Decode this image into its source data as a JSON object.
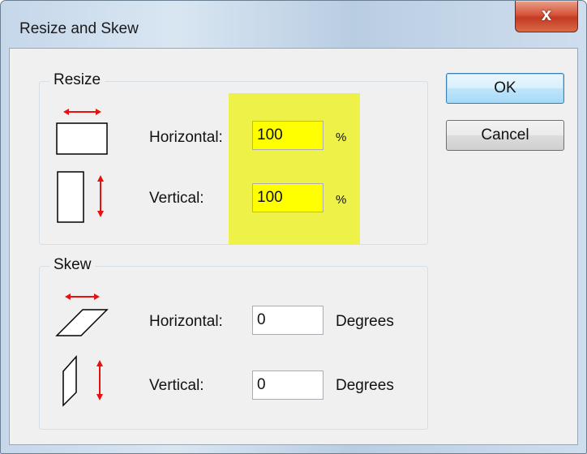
{
  "window": {
    "title": "Resize and Skew",
    "close_glyph": "x"
  },
  "buttons": {
    "ok": "OK",
    "cancel": "Cancel"
  },
  "resize": {
    "label": "Resize",
    "horizontal_label": "Horizontal:",
    "horizontal_value": "100",
    "horizontal_unit": "%",
    "vertical_label": "Vertical:",
    "vertical_value": "100",
    "vertical_unit": "%"
  },
  "skew": {
    "label": "Skew",
    "horizontal_label": "Horizontal:",
    "horizontal_value": "0",
    "horizontal_unit": "Degrees",
    "vertical_label": "Vertical:",
    "vertical_value": "0",
    "vertical_unit": "Degrees"
  },
  "colors": {
    "highlight": "#eef23a",
    "arrow": "#e81010"
  },
  "icons": [
    "resize-horizontal-icon",
    "resize-vertical-icon",
    "skew-horizontal-icon",
    "skew-vertical-icon",
    "close-icon"
  ]
}
